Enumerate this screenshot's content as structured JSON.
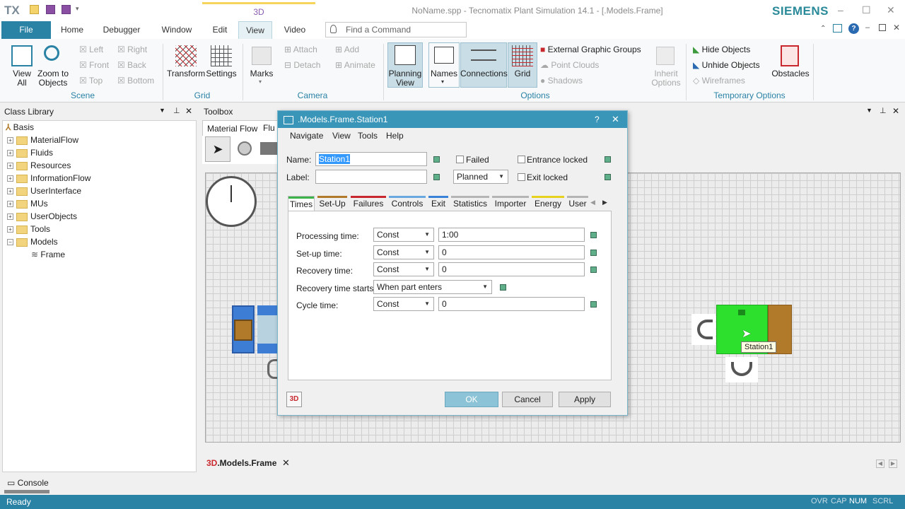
{
  "titlebar": {
    "logo": "TX",
    "tab_3d": "3D",
    "window_title": "NoName.spp - Tecnomatix Plant Simulation 14.1 - [.Models.Frame]",
    "brand": "SIEMENS",
    "controls": [
      "–",
      "☐",
      "✕"
    ]
  },
  "ribbon_tabs": [
    "File",
    "Home",
    "Debugger",
    "Window",
    "Edit",
    "View",
    "Video"
  ],
  "active_tab": "View",
  "command_search": {
    "placeholder": "Find a Command"
  },
  "ribbon": {
    "scene": {
      "label": "Scene",
      "view_all": [
        "View",
        "All"
      ],
      "zoom": [
        "Zoom to",
        "Objects"
      ],
      "left": "Left",
      "right": "Right",
      "front": "Front",
      "back": "Back",
      "top": "Top",
      "bottom": "Bottom"
    },
    "grid": {
      "label": "Grid",
      "transform": "Transform",
      "settings": "Settings"
    },
    "camera": {
      "label": "Camera",
      "marks": "Marks",
      "attach": "Attach",
      "detach": "Detach",
      "add": "Add",
      "animate": "Animate"
    },
    "options": {
      "label": "Options",
      "planning": [
        "Planning",
        "View"
      ],
      "names": "Names",
      "connections": "Connections",
      "grid": "Grid",
      "external": "External Graphic Groups",
      "point_clouds": "Point Clouds",
      "shadows": "Shadows",
      "inherit": [
        "Inherit",
        "Options"
      ]
    },
    "temporary": {
      "label": "Temporary Options",
      "hide": "Hide Objects",
      "unhide": "Unhide Objects",
      "wireframes": "Wireframes",
      "obstacles": "Obstacles"
    }
  },
  "class_library": {
    "title": "Class Library",
    "root": "Basis",
    "items": [
      "MaterialFlow",
      "Fluids",
      "Resources",
      "InformationFlow",
      "UserInterface",
      "MUs",
      "UserObjects",
      "Tools",
      "Models"
    ],
    "child": "Frame"
  },
  "toolbox": {
    "title": "Toolbox",
    "tabs": [
      "Material Flow",
      "Flu"
    ]
  },
  "frame": {
    "station_tooltip": "Station1",
    "tab_label": ".Models.Frame",
    "tab_icon": "3D"
  },
  "console": {
    "title": "Console"
  },
  "statusbar": {
    "status": "Ready",
    "indicators": [
      "OVR",
      "CAP",
      "NUM",
      "SCRL"
    ]
  },
  "dialog": {
    "title": ".Models.Frame.Station1",
    "help": "?",
    "close": "✕",
    "menu": [
      "Navigate",
      "View",
      "Tools",
      "Help"
    ],
    "name_label": "Name:",
    "name_value": "Station1",
    "label_label": "Label:",
    "label_value": "",
    "failed": "Failed",
    "planned": "Planned",
    "entrance_locked": "Entrance locked",
    "exit_locked": "Exit locked",
    "tabs": [
      {
        "label": "Times",
        "color": "#3cb44b"
      },
      {
        "label": "Set-Up",
        "color": "#b07a2a"
      },
      {
        "label": "Failures",
        "color": "#c8282d"
      },
      {
        "label": "Controls",
        "color": "#6aa8e0"
      },
      {
        "label": "Exit",
        "color": "#3a82d8"
      },
      {
        "label": "Statistics",
        "color": "#b4b4b4"
      },
      {
        "label": "Importer",
        "color": "#b4b4b4"
      },
      {
        "label": "Energy",
        "color": "#e6d21e"
      },
      {
        "label": "User",
        "color": "#b4b4b4"
      }
    ],
    "times": {
      "processing": {
        "label": "Processing time:",
        "type": "Const",
        "value": "1:00"
      },
      "setup": {
        "label": "Set-up time:",
        "type": "Const",
        "value": "0"
      },
      "recovery": {
        "label": "Recovery time:",
        "type": "Const",
        "value": "0"
      },
      "recovery_starts": {
        "label": "Recovery time starts:",
        "value": "When part enters"
      },
      "cycle": {
        "label": "Cycle time:",
        "type": "Const",
        "value": "0"
      }
    },
    "btn_3d": "3D",
    "ok": "OK",
    "cancel": "Cancel",
    "apply": "Apply"
  }
}
